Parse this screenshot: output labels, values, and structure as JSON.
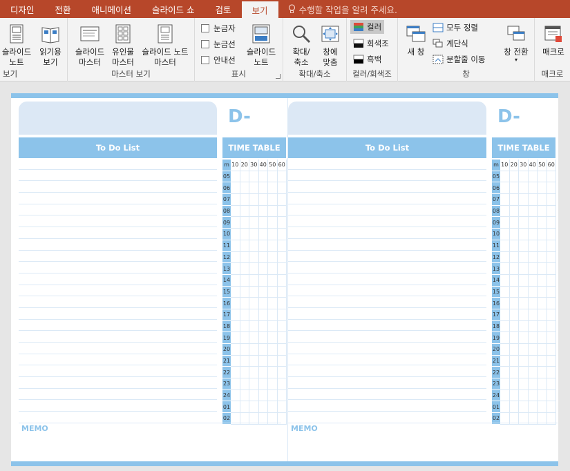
{
  "tabs": {
    "items": [
      "디자인",
      "전환",
      "애니메이션",
      "슬라이드 쇼",
      "검토",
      "보기"
    ],
    "active": "보기",
    "tell_me": "수행할 작업을 알려 주세요."
  },
  "ribbon": {
    "groups": {
      "view": {
        "label": "보기",
        "buttons": [
          {
            "l1": "슬라이드",
            "l2": "노트"
          },
          {
            "l1": "읽기용",
            "l2": "보기"
          }
        ]
      },
      "master": {
        "label": "마스터 보기",
        "buttons": [
          {
            "l1": "슬라이드",
            "l2": "마스터"
          },
          {
            "l1": "유인물",
            "l2": "마스터"
          },
          {
            "l1": "슬라이드 노트",
            "l2": "마스터"
          }
        ]
      },
      "show": {
        "label": "표시",
        "checks": [
          "눈금자",
          "눈금선",
          "안내선"
        ],
        "button": {
          "l1": "슬라이드",
          "l2": "노트"
        }
      },
      "zoom": {
        "label": "확대/축소",
        "buttons": [
          {
            "l1": "확대/",
            "l2": "축소"
          },
          {
            "l1": "창에",
            "l2": "맞춤"
          }
        ]
      },
      "color": {
        "label": "컬러/회색조",
        "items": [
          "컬러",
          "회색조",
          "흑백"
        ]
      },
      "window": {
        "label": "창",
        "new": "새 창",
        "items": [
          "모두 정렬",
          "계단식",
          "분할줄 이동"
        ],
        "switch": "창 전환"
      },
      "macro": {
        "label": "매크로",
        "button": "매크로"
      }
    }
  },
  "slide": {
    "d_label": "D-",
    "todo_title": "To Do List",
    "timetable_title": "TIME TABLE",
    "minutes_header": [
      "m",
      "10",
      "20",
      "30",
      "40",
      "50",
      "60"
    ],
    "hours": [
      "05",
      "06",
      "07",
      "08",
      "09",
      "10",
      "11",
      "12",
      "13",
      "14",
      "15",
      "16",
      "17",
      "18",
      "19",
      "20",
      "21",
      "22",
      "23",
      "24",
      "01",
      "02"
    ],
    "memo": "MEMO"
  },
  "colors": {
    "accent": "#8cc3ea",
    "tabbar": "#b7472a",
    "light": "#dce8f5"
  }
}
